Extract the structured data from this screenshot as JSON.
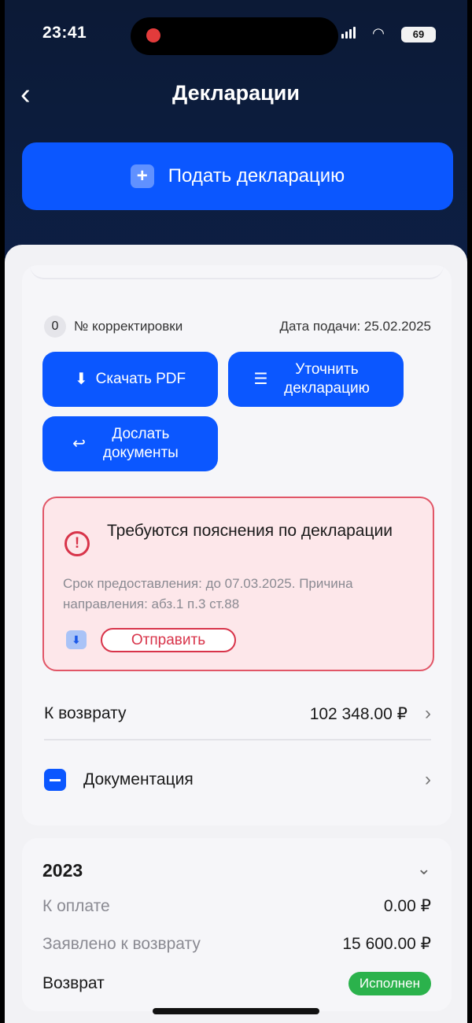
{
  "status_bar": {
    "time": "23:41",
    "battery": "69"
  },
  "header": {
    "back_icon": "chevron-left-icon",
    "title": "Декларации"
  },
  "submit": {
    "label": "Подать декларацию",
    "icon": "plus-icon"
  },
  "declaration": {
    "correction_number": "0",
    "correction_label": "№ корректировки",
    "submission_date": "Дата подачи: 25.02.2025",
    "buttons": {
      "download_pdf": "Скачать PDF",
      "clarify": "Уточнить декларацию",
      "send_documents": "Дослать документы"
    },
    "alert": {
      "title": "Требуются пояснения по декларации",
      "description": "Срок предоставления: до 07.03.2025. Причина направления: абз.1 п.3 ст.88",
      "send_label": "Отправить"
    },
    "refund": {
      "label": "К возврату",
      "value": "102 348.00 ₽"
    },
    "documentation": {
      "label": "Документация"
    }
  },
  "year_card": {
    "year": "2023",
    "rows": [
      {
        "label": "К оплате",
        "value": "0.00 ₽"
      },
      {
        "label": "Заявлено к возврату",
        "value": "15 600.00 ₽"
      }
    ],
    "status_label": "Возврат",
    "status_value": "Исполнен"
  },
  "colors": {
    "accent": "#0b57ff",
    "alert_border": "#e15667",
    "alert_bg": "#fde7ea",
    "success": "#2bb24c"
  }
}
